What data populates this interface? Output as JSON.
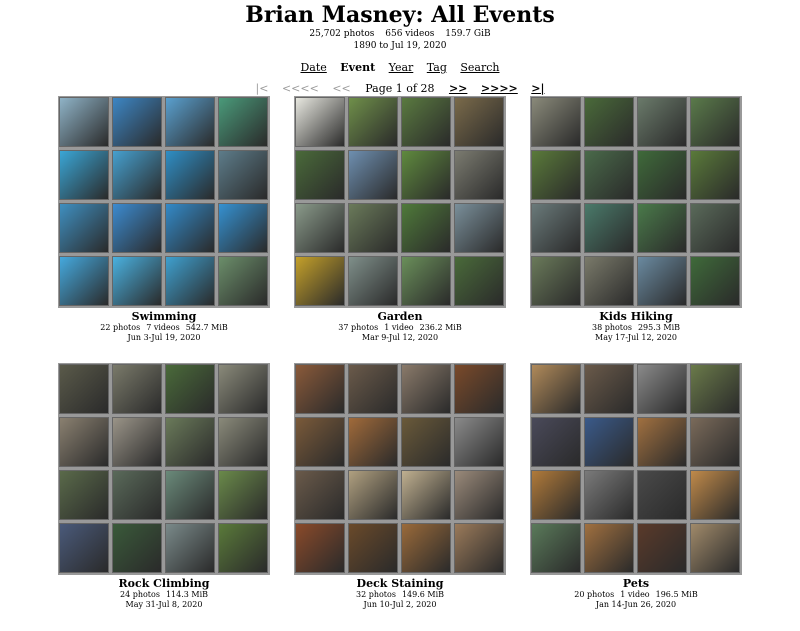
{
  "header": {
    "title": "Brian Masney: All Events",
    "photos": "25,702 photos",
    "videos": "656 videos",
    "size": "159.7 GiB",
    "date_range": "1890 to Jul 19, 2020"
  },
  "nav": {
    "date": "Date",
    "event": "Event",
    "year": "Year",
    "tag": "Tag",
    "search": "Search"
  },
  "pager": {
    "first": "|<",
    "back_far": "<<<<",
    "back": "<<",
    "label": "Page 1 of 28",
    "next": ">>",
    "next_far": ">>>>",
    "last": ">|"
  },
  "events": [
    {
      "title": "Swimming",
      "photos": "22 photos",
      "videos": "7 videos",
      "size": "542.7 MiB",
      "dates": "Jun 3-Jul 19, 2020",
      "tile_colors": [
        "#8fb3c7",
        "#3d86c4",
        "#5aa0cf",
        "#4a9a7a",
        "#3aa6d6",
        "#46a0cf",
        "#2f8ec5",
        "#5d7c8a",
        "#3f8fc0",
        "#3c8bd0",
        "#338ac8",
        "#3591d1",
        "#45a9de",
        "#4ab1e0",
        "#3fa0cf",
        "#6b8e6a"
      ]
    },
    {
      "title": "Garden",
      "photos": "37 photos",
      "videos": "1 video",
      "size": "236.2 MiB",
      "dates": "Mar 9-Jul 12, 2020",
      "tile_colors": [
        "#e8e8e0",
        "#6f8f4a",
        "#5a7a40",
        "#7a6a4a",
        "#4a6a3a",
        "#6e8fb0",
        "#5f8a3e",
        "#7b7b70",
        "#8a9a8a",
        "#6a7a5a",
        "#4f7a3a",
        "#7a8f9a",
        "#c4a02a",
        "#7f8f8a",
        "#6a8f5a",
        "#4a6a3a"
      ]
    },
    {
      "title": "Kids Hiking",
      "photos": "38 photos",
      "videos": "",
      "size": "295.3 MiB",
      "dates": "May 17-Jul 12, 2020",
      "tile_colors": [
        "#8a8a7a",
        "#4a6a3a",
        "#6a7a6a",
        "#5a7a4a",
        "#5a7a3a",
        "#4a6a4a",
        "#3f6a3a",
        "#5a7a3a",
        "#6a7a7a",
        "#4a7a6a",
        "#4a7a4a",
        "#5a6a5a",
        "#6a7a5a",
        "#7a7a6a",
        "#6a8aa0",
        "#3f6a3a"
      ]
    },
    {
      "title": "Rock Climbing",
      "photos": "24 photos",
      "videos": "",
      "size": "114.3 MiB",
      "dates": "May 31-Jul 8, 2020",
      "tile_colors": [
        "#5a5a4a",
        "#7a7a6a",
        "#4a6a3a",
        "#8a8a7a",
        "#8a8070",
        "#9a9488",
        "#6a7a5a",
        "#8a8a7a",
        "#5a6a4a",
        "#5a6a5a",
        "#6a8a7a",
        "#6a8a4a",
        "#4a5a7a",
        "#3a5a3a",
        "#7a8a8a",
        "#5a7a3a"
      ]
    },
    {
      "title": "Deck Staining",
      "photos": "32 photos",
      "videos": "",
      "size": "149.6 MiB",
      "dates": "Jun 10-Jul 2, 2020",
      "tile_colors": [
        "#8a5a3a",
        "#6a5a4a",
        "#8a7a6a",
        "#7a4a2a",
        "#7a5a3a",
        "#a06a3a",
        "#6a5a3a",
        "#8a8a8a",
        "#6a5a4a",
        "#b0a080",
        "#c0b090",
        "#9a8a7a",
        "#8a4a2a",
        "#6a4a2a",
        "#9a6a3a",
        "#9a7a5a"
      ]
    },
    {
      "title": "Pets",
      "photos": "20 photos",
      "videos": "1 video",
      "size": "196.5 MiB",
      "dates": "Jan 14-Jun 26, 2020",
      "tile_colors": [
        "#b08a5a",
        "#6a5a4a",
        "#8a8a8a",
        "#6a7a4a",
        "#4a4a5a",
        "#3a5a8a",
        "#a07040",
        "#7a6a5a",
        "#b07a3a",
        "#7a7a7a",
        "#4a4a4a",
        "#c08a4a",
        "#5a7a5a",
        "#a07040",
        "#5a3a2a",
        "#a08a6a"
      ]
    }
  ]
}
